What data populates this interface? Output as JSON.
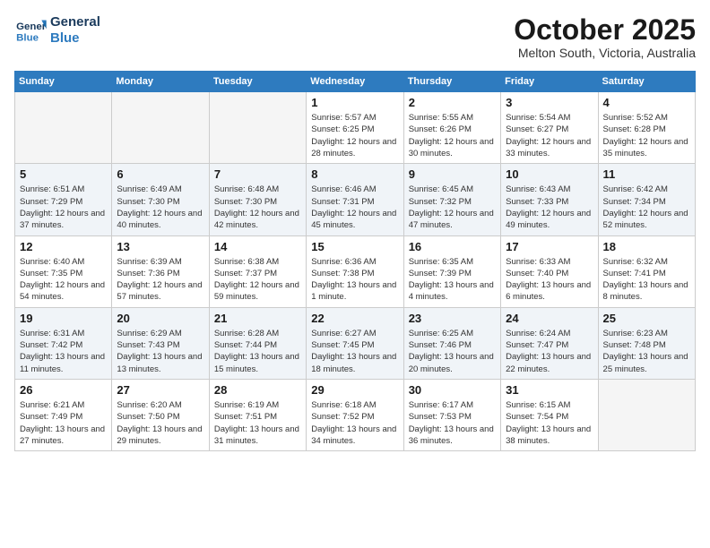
{
  "header": {
    "logo_line1": "General",
    "logo_line2": "Blue",
    "month": "October 2025",
    "location": "Melton South, Victoria, Australia"
  },
  "days_of_week": [
    "Sunday",
    "Monday",
    "Tuesday",
    "Wednesday",
    "Thursday",
    "Friday",
    "Saturday"
  ],
  "weeks": [
    [
      {
        "day": "",
        "empty": true
      },
      {
        "day": "",
        "empty": true
      },
      {
        "day": "",
        "empty": true
      },
      {
        "day": "1",
        "sunrise": "5:57 AM",
        "sunset": "6:25 PM",
        "daylight": "12 hours and 28 minutes."
      },
      {
        "day": "2",
        "sunrise": "5:55 AM",
        "sunset": "6:26 PM",
        "daylight": "12 hours and 30 minutes."
      },
      {
        "day": "3",
        "sunrise": "5:54 AM",
        "sunset": "6:27 PM",
        "daylight": "12 hours and 33 minutes."
      },
      {
        "day": "4",
        "sunrise": "5:52 AM",
        "sunset": "6:28 PM",
        "daylight": "12 hours and 35 minutes."
      }
    ],
    [
      {
        "day": "5",
        "sunrise": "6:51 AM",
        "sunset": "7:29 PM",
        "daylight": "12 hours and 37 minutes."
      },
      {
        "day": "6",
        "sunrise": "6:49 AM",
        "sunset": "7:30 PM",
        "daylight": "12 hours and 40 minutes."
      },
      {
        "day": "7",
        "sunrise": "6:48 AM",
        "sunset": "7:30 PM",
        "daylight": "12 hours and 42 minutes."
      },
      {
        "day": "8",
        "sunrise": "6:46 AM",
        "sunset": "7:31 PM",
        "daylight": "12 hours and 45 minutes."
      },
      {
        "day": "9",
        "sunrise": "6:45 AM",
        "sunset": "7:32 PM",
        "daylight": "12 hours and 47 minutes."
      },
      {
        "day": "10",
        "sunrise": "6:43 AM",
        "sunset": "7:33 PM",
        "daylight": "12 hours and 49 minutes."
      },
      {
        "day": "11",
        "sunrise": "6:42 AM",
        "sunset": "7:34 PM",
        "daylight": "12 hours and 52 minutes."
      }
    ],
    [
      {
        "day": "12",
        "sunrise": "6:40 AM",
        "sunset": "7:35 PM",
        "daylight": "12 hours and 54 minutes."
      },
      {
        "day": "13",
        "sunrise": "6:39 AM",
        "sunset": "7:36 PM",
        "daylight": "12 hours and 57 minutes."
      },
      {
        "day": "14",
        "sunrise": "6:38 AM",
        "sunset": "7:37 PM",
        "daylight": "12 hours and 59 minutes."
      },
      {
        "day": "15",
        "sunrise": "6:36 AM",
        "sunset": "7:38 PM",
        "daylight": "13 hours and 1 minute."
      },
      {
        "day": "16",
        "sunrise": "6:35 AM",
        "sunset": "7:39 PM",
        "daylight": "13 hours and 4 minutes."
      },
      {
        "day": "17",
        "sunrise": "6:33 AM",
        "sunset": "7:40 PM",
        "daylight": "13 hours and 6 minutes."
      },
      {
        "day": "18",
        "sunrise": "6:32 AM",
        "sunset": "7:41 PM",
        "daylight": "13 hours and 8 minutes."
      }
    ],
    [
      {
        "day": "19",
        "sunrise": "6:31 AM",
        "sunset": "7:42 PM",
        "daylight": "13 hours and 11 minutes."
      },
      {
        "day": "20",
        "sunrise": "6:29 AM",
        "sunset": "7:43 PM",
        "daylight": "13 hours and 13 minutes."
      },
      {
        "day": "21",
        "sunrise": "6:28 AM",
        "sunset": "7:44 PM",
        "daylight": "13 hours and 15 minutes."
      },
      {
        "day": "22",
        "sunrise": "6:27 AM",
        "sunset": "7:45 PM",
        "daylight": "13 hours and 18 minutes."
      },
      {
        "day": "23",
        "sunrise": "6:25 AM",
        "sunset": "7:46 PM",
        "daylight": "13 hours and 20 minutes."
      },
      {
        "day": "24",
        "sunrise": "6:24 AM",
        "sunset": "7:47 PM",
        "daylight": "13 hours and 22 minutes."
      },
      {
        "day": "25",
        "sunrise": "6:23 AM",
        "sunset": "7:48 PM",
        "daylight": "13 hours and 25 minutes."
      }
    ],
    [
      {
        "day": "26",
        "sunrise": "6:21 AM",
        "sunset": "7:49 PM",
        "daylight": "13 hours and 27 minutes."
      },
      {
        "day": "27",
        "sunrise": "6:20 AM",
        "sunset": "7:50 PM",
        "daylight": "13 hours and 29 minutes."
      },
      {
        "day": "28",
        "sunrise": "6:19 AM",
        "sunset": "7:51 PM",
        "daylight": "13 hours and 31 minutes."
      },
      {
        "day": "29",
        "sunrise": "6:18 AM",
        "sunset": "7:52 PM",
        "daylight": "13 hours and 34 minutes."
      },
      {
        "day": "30",
        "sunrise": "6:17 AM",
        "sunset": "7:53 PM",
        "daylight": "13 hours and 36 minutes."
      },
      {
        "day": "31",
        "sunrise": "6:15 AM",
        "sunset": "7:54 PM",
        "daylight": "13 hours and 38 minutes."
      },
      {
        "day": "",
        "empty": true
      }
    ]
  ],
  "labels": {
    "sunrise": "Sunrise:",
    "sunset": "Sunset:",
    "daylight": "Daylight:"
  }
}
